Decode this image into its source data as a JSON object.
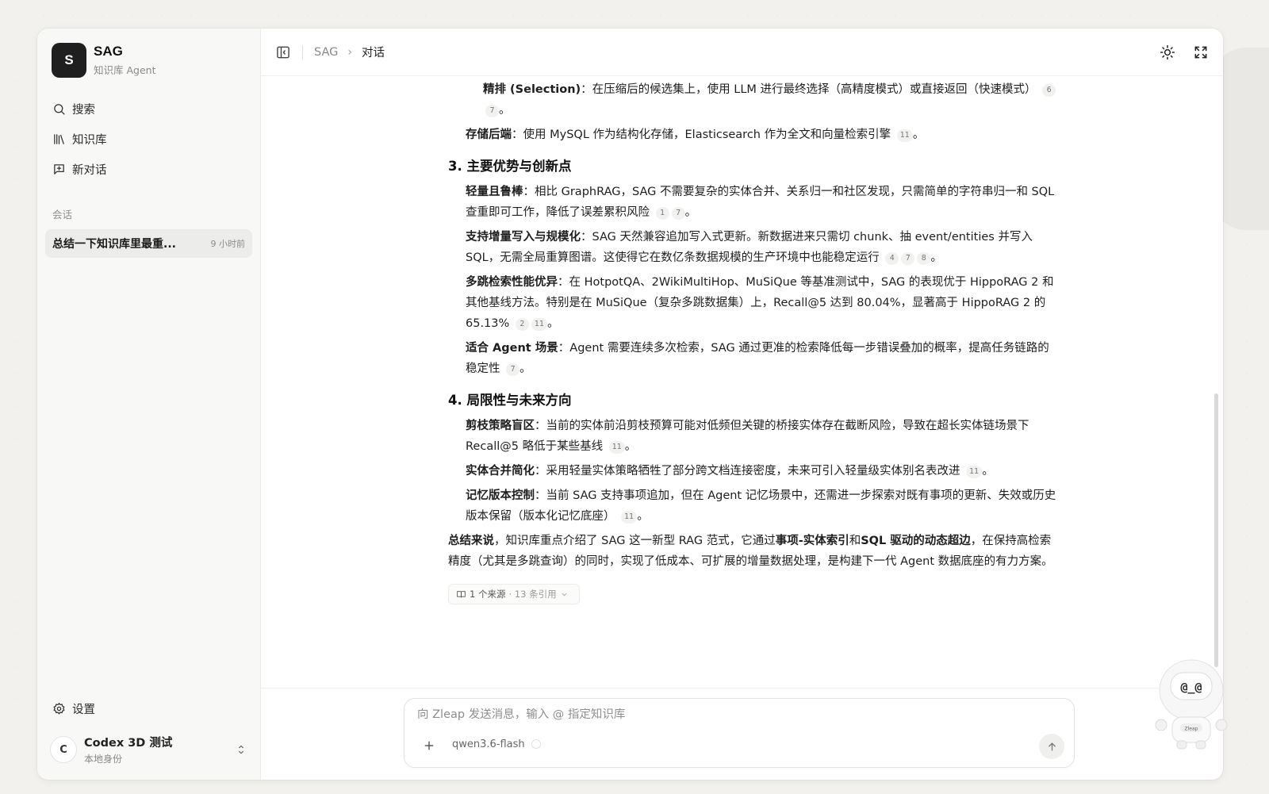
{
  "brand": {
    "logo_letter": "S",
    "title": "SAG",
    "subtitle": "知识库 Agent"
  },
  "nav": [
    {
      "label": "搜索",
      "icon": "search-icon"
    },
    {
      "label": "知识库",
      "icon": "library-icon"
    },
    {
      "label": "新对话",
      "icon": "new-chat-icon"
    }
  ],
  "sessions_label": "会话",
  "sessions": [
    {
      "title": "总结一下知识库里最重...",
      "time": "9 小时前"
    }
  ],
  "settings_label": "设置",
  "user": {
    "initial": "C",
    "name": "Codex 3D 测试",
    "subtitle": "本地身份"
  },
  "breadcrumb": {
    "root": "SAG",
    "separator": "›",
    "current": "对话"
  },
  "article": {
    "p_selection": {
      "bold": "精排 (Selection)",
      "text": "：在压缩后的候选集上，使用 LLM 进行最终选择（高精度模式）或直接返回（快速模式）",
      "cites": [
        "6",
        "7"
      ],
      "end": "。"
    },
    "p_storage": {
      "bold": "存储后端",
      "text": "：使用 MySQL 作为结构化存储，Elasticsearch 作为全文和向量检索引擎",
      "cites": [
        "11"
      ],
      "end": "。"
    },
    "h_advantages": "3. 主要优势与创新点",
    "p_light": {
      "bold": "轻量且鲁棒",
      "text": "：相比 GraphRAG，SAG 不需要复杂的实体合并、关系归一和社区发现，只需简单的字符串归一和 SQL 查重即可工作，降低了误差累积风险",
      "cites": [
        "1",
        "7"
      ],
      "end": "。"
    },
    "p_incremental": {
      "bold": "支持增量写入与规模化",
      "text": "：SAG 天然兼容追加写入式更新。新数据进来只需切 chunk、抽 event/entities 并写入 SQL，无需全局重算图谱。这使得它在数亿条数据规模的生产环境中也能稳定运行",
      "cites": [
        "4",
        "7",
        "8"
      ],
      "end": "。"
    },
    "p_multihop": {
      "bold": "多跳检索性能优异",
      "text": "：在 HotpotQA、2WikiMultiHop、MuSiQue 等基准测试中，SAG 的表现优于 HippoRAG 2 和其他基线方法。特别是在 MuSiQue（复杂多跳数据集）上，Recall@5 达到 80.04%，显著高于 HippoRAG 2 的 65.13%",
      "cites": [
        "2",
        "11"
      ],
      "end": "。"
    },
    "p_agent": {
      "bold": "适合 Agent 场景",
      "text": "：Agent 需要连续多次检索，SAG 通过更准的检索降低每一步错误叠加的概率，提高任务链路的稳定性",
      "cites": [
        "7"
      ],
      "end": "。"
    },
    "h_limits": "4. 局限性与未来方向",
    "p_pruning": {
      "bold": "剪枝策略盲区",
      "text": "：当前的实体前沿剪枝预算可能对低频但关键的桥接实体存在截断风险，导致在超长实体链场景下 Recall@5 略低于某些基线",
      "cites": [
        "11"
      ],
      "end": "。"
    },
    "p_merge": {
      "bold": "实体合并简化",
      "text": "：采用轻量实体策略牺牲了部分跨文档连接密度，未来可引入轻量级实体别名表改进",
      "cites": [
        "11"
      ],
      "end": "。"
    },
    "p_version": {
      "bold": "记忆版本控制",
      "text": "：当前 SAG 支持事项追加，但在 Agent 记忆场景中，还需进一步探索对既有事项的更新、失效或历史版本保留（版本化记忆底座）",
      "cites": [
        "11"
      ],
      "end": "。"
    },
    "summary": {
      "bold1": "总结来说",
      "text1": "，知识库重点介绍了 SAG 这一新型 RAG 范式，它通过",
      "bold2": "事项-实体索引",
      "text2": "和",
      "bold3": "SQL 驱动的动态超边",
      "text3": "，在保持高检索精度（尤其是多跳查询）的同时，实现了低成本、可扩展的增量数据处理，是构建下一代 Agent 数据底座的有力方案。"
    },
    "sources": {
      "label": "1 个来源",
      "refs": "· 13 条引用"
    }
  },
  "composer": {
    "placeholder": "向 Zleap 发送消息，输入 @ 指定知识库",
    "model": "qwen3.6-flash"
  },
  "mascot": {
    "face": "@_@",
    "badge": "Zleap"
  }
}
